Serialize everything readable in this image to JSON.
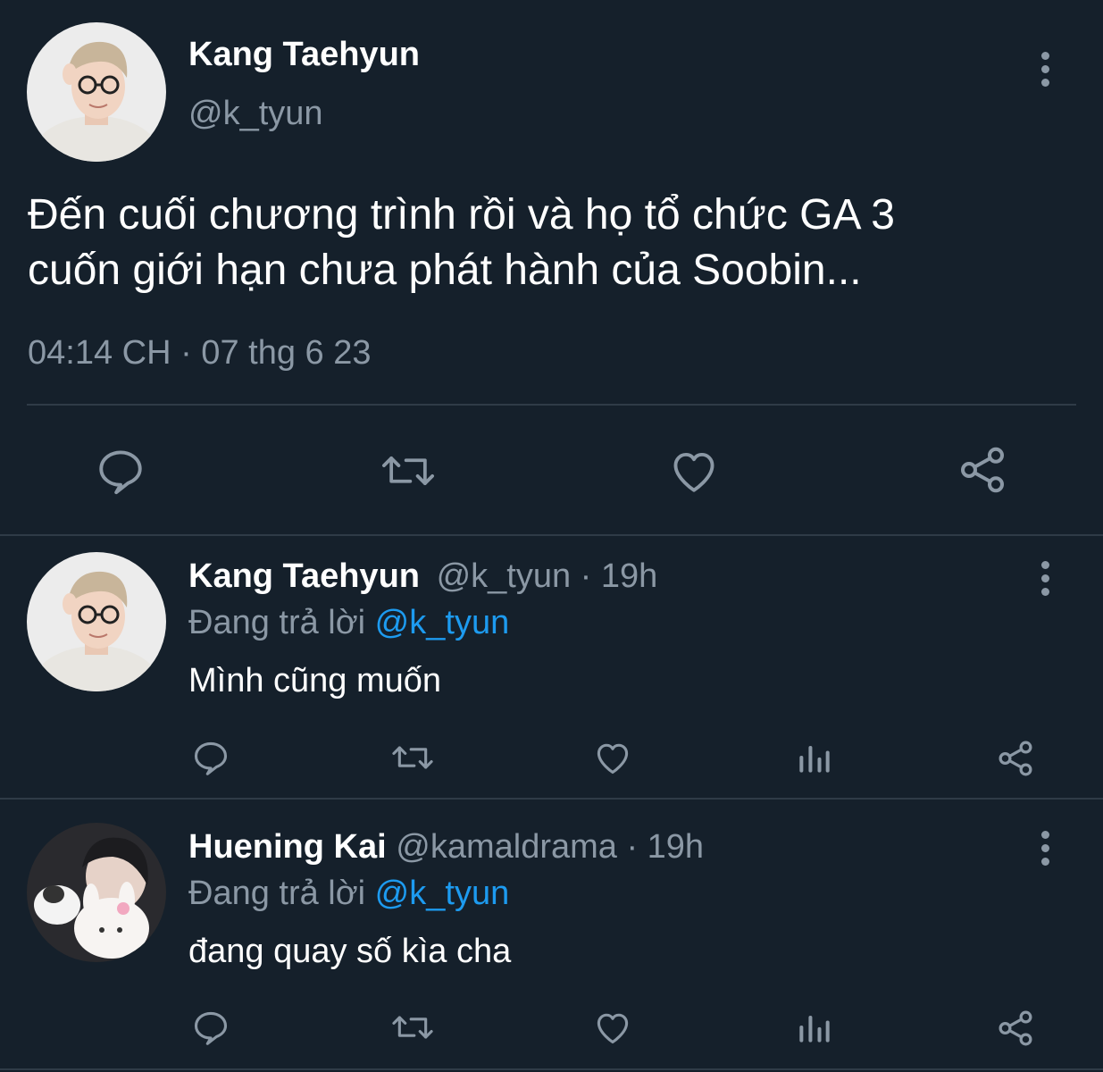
{
  "main_tweet": {
    "author_name": "Kang Taehyun",
    "handle": "@k_tyun",
    "text_line1": "Đến cuối chương trình rồi và họ tổ chức GA 3",
    "text_line2": "cuốn giới hạn chưa phát hành của Soobin...",
    "timestamp": "04:14 CH · 07 thg 6 23",
    "actions": [
      "reply-icon",
      "retweet-icon",
      "like-icon",
      "share-icon"
    ]
  },
  "replies": [
    {
      "author_name": "Kang Taehyun",
      "handle_time": "@k_tyun · 19h",
      "replying_prefix": "Đang trả lời",
      "replying_to": "@k_tyun",
      "text": "Mình cũng muốn",
      "actions": [
        "reply-icon",
        "retweet-icon",
        "like-icon",
        "analytics-icon",
        "share-icon"
      ]
    },
    {
      "author_name": "Huening Kai",
      "handle_time": "@kamaldrama · 19h",
      "replying_prefix": "Đang trả lời",
      "replying_to": "@k_tyun",
      "text": "đang quay số kìa cha",
      "actions": [
        "reply-icon",
        "retweet-icon",
        "like-icon",
        "analytics-icon",
        "share-icon"
      ]
    }
  ],
  "colors": {
    "background": "#15202b",
    "secondary_text": "#8b98a5",
    "link": "#1d9bf0",
    "divider": "#2f3b47"
  }
}
